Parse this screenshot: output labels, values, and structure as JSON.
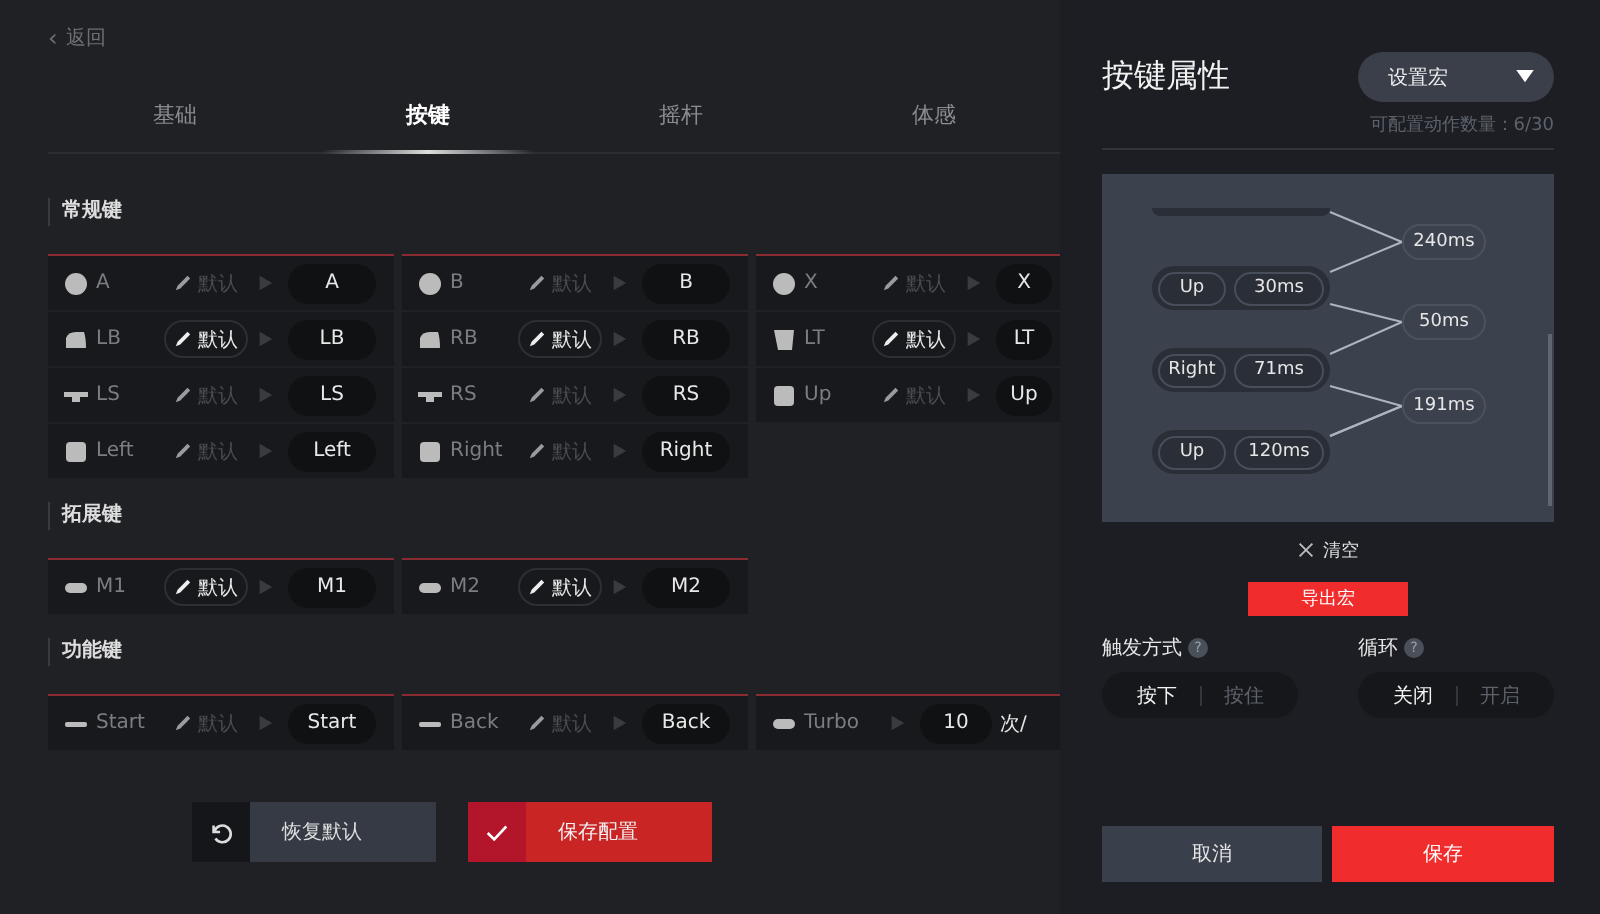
{
  "back": {
    "icon": "‹",
    "label": "返回"
  },
  "tabs": [
    {
      "label": "基础",
      "selected": false
    },
    {
      "label": "按键",
      "selected": true
    },
    {
      "label": "摇杆",
      "selected": false
    },
    {
      "label": "体感",
      "selected": false
    }
  ],
  "sections": [
    {
      "title": "常规键",
      "cells": [
        {
          "kind": "circle",
          "label": "A",
          "edit": "默认",
          "enabled": false,
          "mapped": "A"
        },
        {
          "kind": "circle",
          "label": "B",
          "edit": "默认",
          "enabled": false,
          "mapped": "B"
        },
        {
          "kind": "circle",
          "label": "X",
          "edit": "默认",
          "enabled": false,
          "mapped": "X"
        },
        {
          "kind": "bumper",
          "label": "LB",
          "edit": "默认",
          "enabled": true,
          "mapped": "LB"
        },
        {
          "kind": "bumper",
          "label": "RB",
          "edit": "默认",
          "enabled": true,
          "mapped": "RB"
        },
        {
          "kind": "trigger",
          "label": "LT",
          "edit": "默认",
          "enabled": true,
          "mapped": "LT"
        },
        {
          "kind": "stick",
          "label": "LS",
          "edit": "默认",
          "enabled": false,
          "mapped": "LS"
        },
        {
          "kind": "stick",
          "label": "RS",
          "edit": "默认",
          "enabled": false,
          "mapped": "RS"
        },
        {
          "kind": "pad",
          "label": "Up",
          "edit": "默认",
          "enabled": false,
          "mapped": "Up"
        },
        {
          "kind": "pad",
          "label": "Left",
          "edit": "默认",
          "enabled": false,
          "mapped": "Left"
        },
        {
          "kind": "pad",
          "label": "Right",
          "edit": "默认",
          "enabled": false,
          "mapped": "Right"
        }
      ]
    },
    {
      "title": "拓展键",
      "cells": [
        {
          "kind": "paddle",
          "label": "M1",
          "edit": "默认",
          "enabled": true,
          "mapped": "M1"
        },
        {
          "kind": "paddle",
          "label": "M2",
          "edit": "默认",
          "enabled": true,
          "mapped": "M2"
        }
      ]
    },
    {
      "title": "功能键",
      "cells": [
        {
          "kind": "dash",
          "label": "Start",
          "edit": "默认",
          "enabled": false,
          "mapped": "Start"
        },
        {
          "kind": "dash",
          "label": "Back",
          "edit": "默认",
          "enabled": false,
          "mapped": "Back"
        },
        {
          "kind": "turbo",
          "label": "Turbo",
          "value": "10",
          "unit": "次/"
        }
      ]
    }
  ],
  "actions": [
    {
      "kind": "reset",
      "label": "恢复默认"
    },
    {
      "kind": "save",
      "label": "保存配置"
    }
  ],
  "panel": {
    "title": "按键属性",
    "mode": "设置宏",
    "count": "可配置动作数量：6/30",
    "macro": {
      "steps": [
        {
          "key": "Up",
          "time": "30ms"
        },
        {
          "key": "Right",
          "time": "71ms"
        },
        {
          "key": "Up",
          "time": "120ms"
        }
      ],
      "delays": [
        "240ms",
        "50ms",
        "191ms"
      ]
    },
    "clear": "清空",
    "export": "导出宏",
    "options": [
      {
        "title": "触发方式",
        "help": "?",
        "choices": [
          {
            "label": "按下",
            "selected": true
          },
          {
            "label": "按住",
            "selected": false
          }
        ]
      },
      {
        "title": "循环",
        "help": "?",
        "choices": [
          {
            "label": "关闭",
            "selected": true
          },
          {
            "label": "开启",
            "selected": false
          }
        ]
      }
    ],
    "cancel": "取消",
    "save": "保存"
  }
}
